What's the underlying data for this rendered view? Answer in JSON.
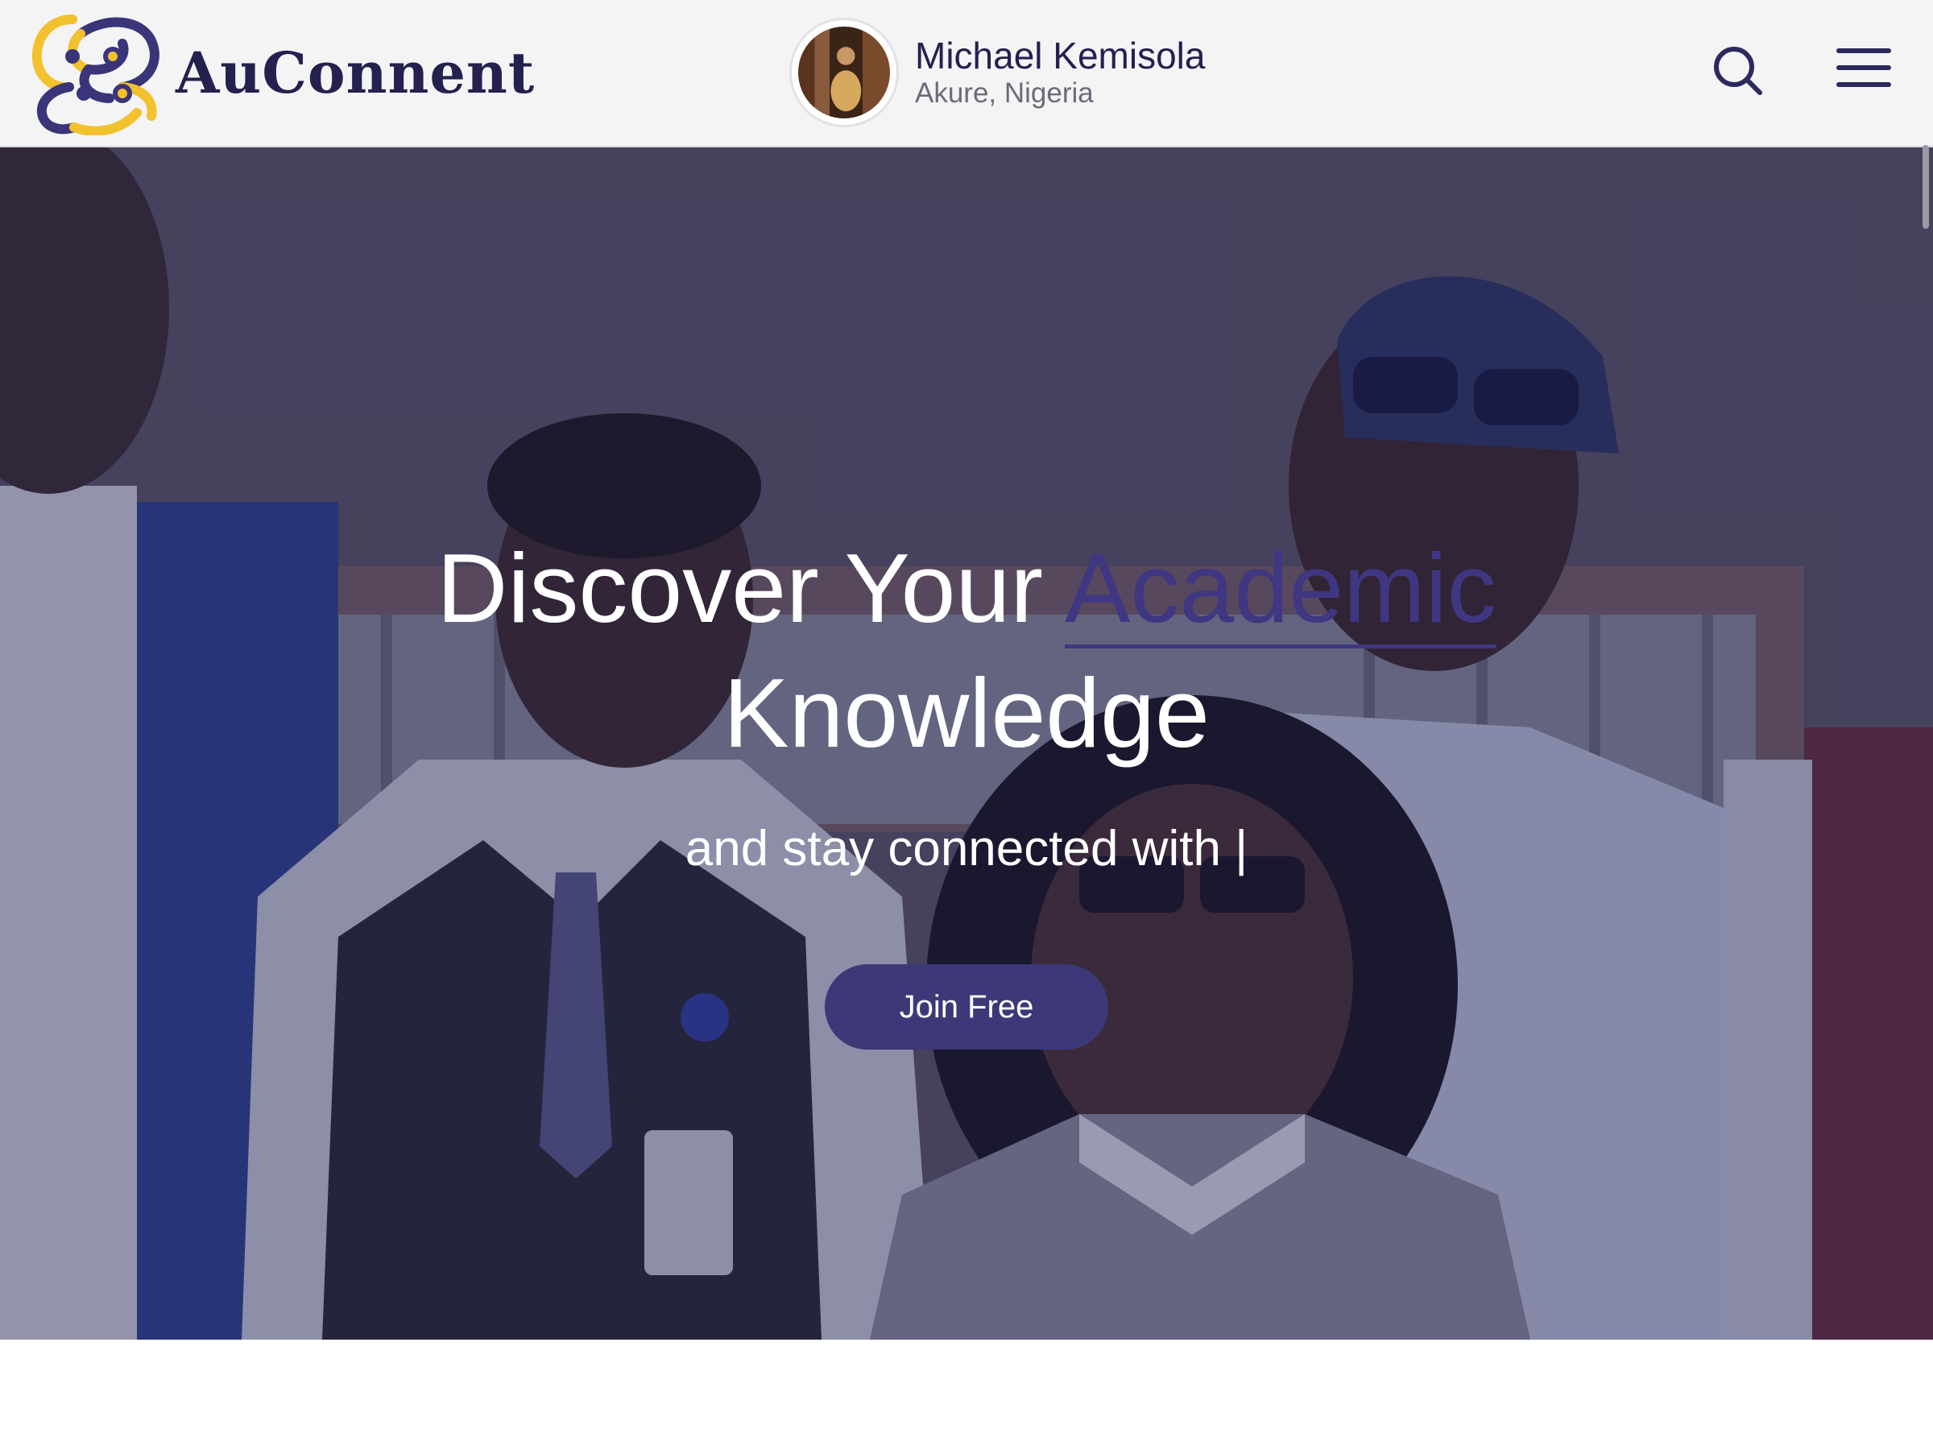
{
  "brand": {
    "name": "AuConnent",
    "colors": {
      "primary": "#24214e",
      "accent": "#f2c12e",
      "button": "#3d3878"
    }
  },
  "header": {
    "profile": {
      "name": "Michael Kemisola",
      "location": "Akure, Nigeria"
    },
    "icons": {
      "search": "search-icon",
      "menu": "hamburger-menu-icon"
    }
  },
  "hero": {
    "title_part1": "Discover Your ",
    "title_accent": "Academic",
    "title_part2": "Knowledge",
    "subtitle": "and stay connected with |",
    "cta_label": "Join Free"
  }
}
